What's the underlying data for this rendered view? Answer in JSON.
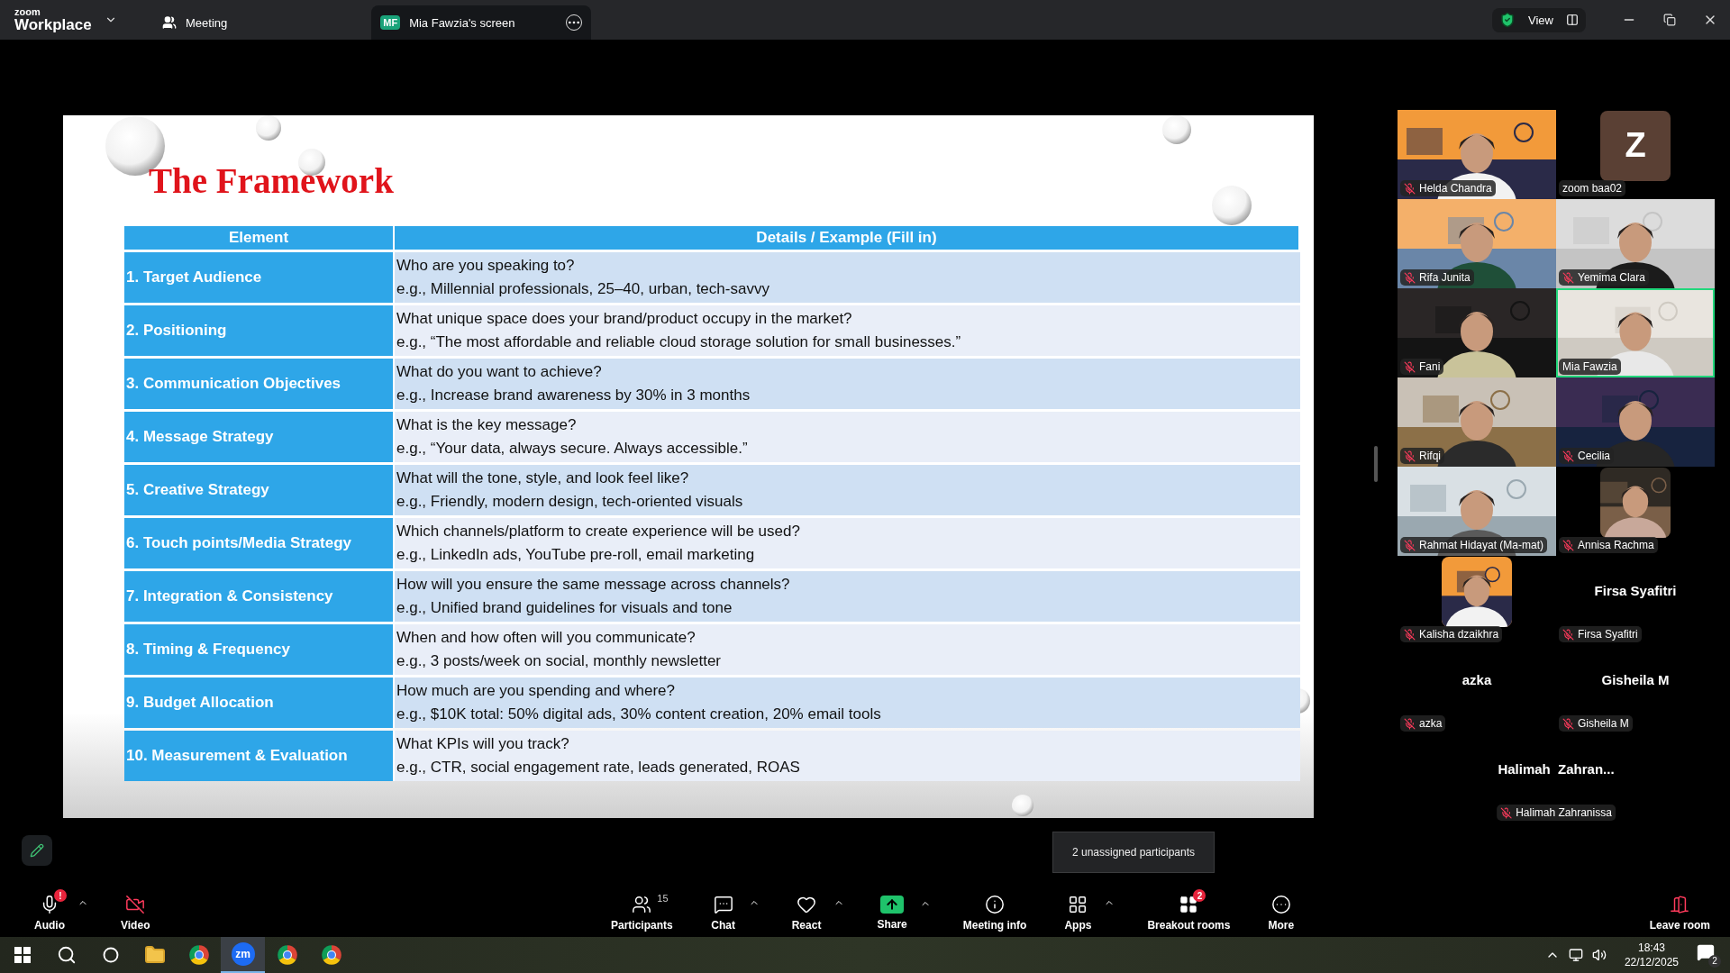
{
  "title_bar": {
    "logo_top": "zoom",
    "logo_bottom": "Workplace",
    "view_label": "View",
    "tabs": [
      {
        "label": "Meeting",
        "kind": "meeting",
        "selected": false
      },
      {
        "label": "Mia Fawzia's screen",
        "kind": "share",
        "badge": "MF",
        "selected": true
      }
    ]
  },
  "slide": {
    "title": "The Framework",
    "columns": [
      "Element",
      "Details / Example (Fill in)"
    ],
    "rows": [
      {
        "element": "1. Target Audience",
        "question": "Who are you speaking to?",
        "example": "e.g., Millennial professionals, 25–40, urban, tech-savvy"
      },
      {
        "element": "2. Positioning",
        "question": "What unique space does your brand/product occupy in the market?",
        "example": "e.g., “The most affordable and reliable cloud storage solution for small businesses.”"
      },
      {
        "element": "3. Communication Objectives",
        "question": "What do you want to achieve?",
        "example": "e.g., Increase brand awareness by 30% in 3 months"
      },
      {
        "element": "4. Message Strategy",
        "question": "What is the key message?",
        "example": "e.g., “Your data, always secure. Always accessible.”"
      },
      {
        "element": "5. Creative Strategy",
        "question": "What will the tone, style, and look feel like?",
        "example": "e.g., Friendly, modern design, tech-oriented visuals"
      },
      {
        "element": "6. Touch points/Media Strategy",
        "question": "Which channels/platform to create experience will be used?",
        "example": "e.g., LinkedIn ads, YouTube pre-roll, email marketing"
      },
      {
        "element": "7. Integration & Consistency",
        "question": "How will you ensure the same message across channels?",
        "example": "e.g., Unified brand guidelines for visuals and tone"
      },
      {
        "element": "8. Timing & Frequency",
        "question": "When and how often will you communicate?",
        "example": "e.g., 3 posts/week on social, monthly newsletter"
      },
      {
        "element": "9. Budget Allocation",
        "question": "How much are you spending and where?",
        "example": "e.g., $10K total: 50% digital ads, 30% content creation, 20% email tools"
      },
      {
        "element": "10. Measurement & Evaluation",
        "question": "What KPIs will you track?",
        "example": "e.g., CTR, social engagement rate, leads generated, ROAS"
      }
    ]
  },
  "participants": [
    {
      "name": "Helda Chandra",
      "kind": "video",
      "muted": true,
      "highlighted": false
    },
    {
      "name": "zoom baa02",
      "kind": "letter",
      "letter": "Z",
      "muted": false,
      "highlighted": false
    },
    {
      "name": "Rifa Junita",
      "kind": "video",
      "muted": true,
      "highlighted": false
    },
    {
      "name": "Yemima Clara",
      "kind": "video",
      "muted": true,
      "highlighted": false
    },
    {
      "name": "Fani",
      "kind": "video",
      "muted": true,
      "highlighted": false
    },
    {
      "name": "Mia Fawzia",
      "kind": "video",
      "muted": false,
      "highlighted": true
    },
    {
      "name": "Rifqi",
      "kind": "video",
      "muted": true,
      "highlighted": false
    },
    {
      "name": "Cecilia",
      "kind": "video",
      "muted": true,
      "highlighted": false
    },
    {
      "name": "Rahmat Hidayat (Ma-mat)",
      "kind": "video",
      "muted": true,
      "highlighted": false
    },
    {
      "name": "Annisa Rachma",
      "muted": true,
      "highlighted": false
    },
    {
      "name": "Kalisha dzaikhra",
      "muted": true,
      "highlighted": false
    },
    {
      "name": "Firsa Syafitri",
      "kind": "name",
      "display": "Firsa Syafitri",
      "muted": true,
      "highlighted": false
    },
    {
      "name": "azka",
      "kind": "name",
      "display": "azka",
      "muted": true,
      "highlighted": false
    },
    {
      "name": "Gisheila M",
      "kind": "name",
      "display": "Gisheila M",
      "muted": true,
      "highlighted": false
    },
    {
      "name": "Halimah Zahranissa",
      "kind": "name",
      "display": "Halimah  Zahran...",
      "wide": true,
      "muted": true,
      "highlighted": false
    }
  ],
  "tooltip": "2 unassigned participants",
  "toolbar": {
    "left": [
      {
        "label": "Audio",
        "kind": "audio",
        "badge": "!",
        "has_menu": true
      },
      {
        "label": "Video",
        "kind": "video"
      }
    ],
    "center": [
      {
        "label": "Participants",
        "kind": "participants",
        "count": "15"
      },
      {
        "label": "Chat",
        "kind": "chat",
        "has_menu": true
      },
      {
        "label": "React",
        "kind": "react",
        "has_menu": true
      },
      {
        "label": "Share",
        "kind": "share",
        "has_menu": true
      },
      {
        "label": "Meeting info",
        "kind": "info"
      },
      {
        "label": "Apps",
        "kind": "apps",
        "has_menu": true
      },
      {
        "label": "Breakout rooms",
        "kind": "breakout",
        "badge": "2"
      },
      {
        "label": "More",
        "kind": "more"
      }
    ],
    "right": [
      {
        "label": "Leave room",
        "kind": "leave"
      }
    ]
  },
  "taskbar": {
    "apps": [
      {
        "kind": "explorer",
        "active": false
      },
      {
        "kind": "chrome",
        "active": false
      },
      {
        "kind": "zoom",
        "label": "zm",
        "active": true
      },
      {
        "kind": "chrome",
        "active": false
      },
      {
        "kind": "chrome",
        "active": false
      }
    ],
    "time": "18:43",
    "date": "22/12/2025",
    "notifications": "2"
  }
}
